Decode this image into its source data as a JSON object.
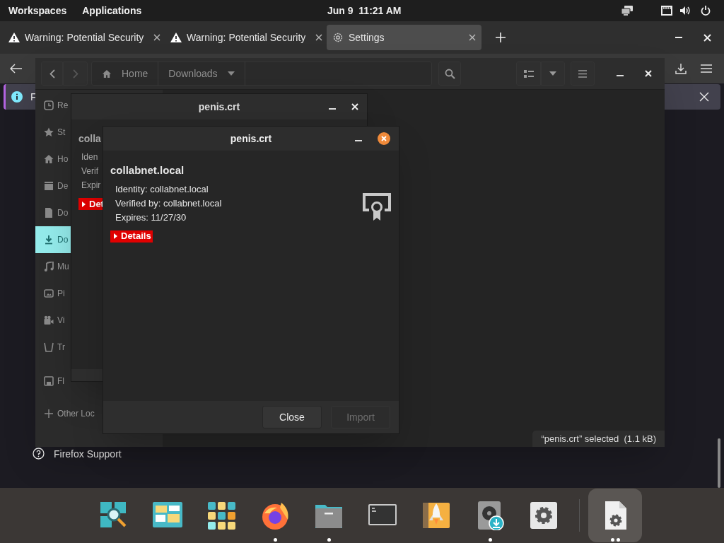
{
  "top_bar": {
    "workspaces": "Workspaces",
    "applications": "Applications",
    "clock": "Jun 9  11:21 AM"
  },
  "browser": {
    "tabs": [
      {
        "kind": "warning",
        "label": "Warning: Potential Security",
        "selected": false
      },
      {
        "kind": "warning",
        "label": "Warning: Potential Security",
        "selected": false
      },
      {
        "kind": "settings",
        "label": "Settings",
        "selected": true
      }
    ],
    "notification": {
      "text": "F"
    },
    "support_link": "Firefox Support"
  },
  "files": {
    "path": [
      {
        "kind": "home",
        "label": "Home"
      },
      {
        "kind": "folder",
        "label": "Downloads"
      }
    ],
    "sidebar": [
      [
        {
          "kind": "recent",
          "label": "Re",
          "selected": false
        },
        {
          "kind": "starred",
          "label": "St",
          "selected": false
        },
        {
          "kind": "home",
          "label": "Ho",
          "selected": false
        },
        {
          "kind": "desktop",
          "label": "De",
          "selected": false
        },
        {
          "kind": "documents",
          "label": "Do",
          "selected": false
        },
        {
          "kind": "downloads",
          "label": "Do",
          "selected": true
        },
        {
          "kind": "music",
          "label": "Mu",
          "selected": false
        },
        {
          "kind": "pictures",
          "label": "Pi",
          "selected": false
        },
        {
          "kind": "videos",
          "label": "Vi",
          "selected": false
        },
        {
          "kind": "trash",
          "label": "Tr",
          "selected": false
        }
      ],
      [
        {
          "kind": "floppy",
          "label": "Fl",
          "selected": false
        }
      ],
      [
        {
          "kind": "add",
          "label": "Other Loc",
          "selected": false
        }
      ]
    ],
    "status": "“penis.crt” selected  (1.1 kB)"
  },
  "dialogs": [
    {
      "title": "penis.crt",
      "focused": false,
      "name": "colla",
      "lines": [
        "Iden",
        "Verif",
        "Expir"
      ],
      "details": "Det"
    },
    {
      "title": "penis.crt",
      "focused": true,
      "name": "collabnet.local",
      "lines": [
        "Identity: collabnet.local",
        "Verified by: collabnet.local",
        "Expires: 11/27/30"
      ],
      "details": "Details",
      "buttons": [
        {
          "label": "Close",
          "disabled": false
        },
        {
          "label": "Import",
          "disabled": true
        }
      ]
    }
  ],
  "dock": [
    {
      "kind": "search",
      "selected": false,
      "running": false
    },
    {
      "kind": "layout",
      "selected": false,
      "running": false
    },
    {
      "kind": "grid",
      "selected": false,
      "running": false
    },
    {
      "kind": "browser",
      "selected": false,
      "running": true
    },
    {
      "kind": "files",
      "selected": false,
      "running": true
    },
    {
      "kind": "terminal",
      "selected": false,
      "running": false
    },
    {
      "kind": "rocket",
      "selected": false,
      "running": false
    },
    {
      "kind": "disk",
      "selected": false,
      "running": true
    },
    {
      "kind": "settings",
      "selected": false,
      "running": false
    },
    {
      "kind": "separator"
    },
    {
      "kind": "certificate",
      "selected": true,
      "running": true,
      "multiple_windows": true
    }
  ]
}
